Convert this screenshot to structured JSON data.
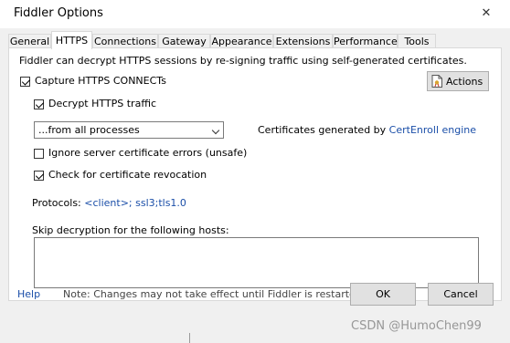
{
  "window": {
    "title": "Fiddler Options",
    "close_glyph": "✕"
  },
  "tabs": [
    {
      "label": "General"
    },
    {
      "label": "HTTPS",
      "active": true
    },
    {
      "label": "Connections"
    },
    {
      "label": "Gateway"
    },
    {
      "label": "Appearance"
    },
    {
      "label": "Extensions"
    },
    {
      "label": "Performance"
    },
    {
      "label": "Tools"
    }
  ],
  "https": {
    "intro": "Fiddler can decrypt HTTPS sessions by re-signing traffic using self-generated certificates.",
    "capture_label": "Capture HTTPS CONNECTs",
    "capture_checked": true,
    "actions_label": "Actions",
    "decrypt_label": "Decrypt HTTPS traffic",
    "decrypt_checked": true,
    "process_filter": "...from all processes",
    "cert_prefix": "Certificates generated by",
    "cert_engine": "CertEnroll engine",
    "ignore_label": "Ignore server certificate errors (unsafe)",
    "ignore_checked": false,
    "revocation_label": "Check for certificate revocation",
    "revocation_checked": true,
    "protocols_label": "Protocols:",
    "protocols_value": "<client>; ssl3;tls1.0",
    "skip_label": "Skip decryption for the following hosts:",
    "skip_value": ""
  },
  "footer": {
    "help": "Help",
    "note": "Note: Changes may not take effect until Fiddler is restarted.",
    "ok": "OK",
    "cancel": "Cancel"
  },
  "watermark": "CSDN @HumoChen99",
  "colors": {
    "link": "#1a4ea8",
    "panel_bg": "#ffffff",
    "dialog_bg": "#f0f0f0"
  }
}
